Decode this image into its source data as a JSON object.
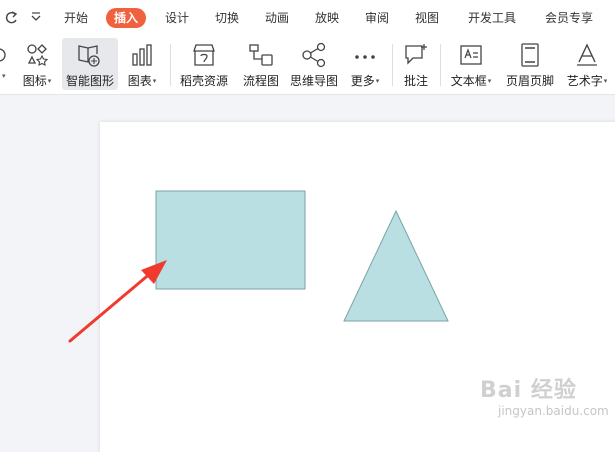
{
  "menubar": {
    "tabs": [
      {
        "key": "home",
        "label": "开始"
      },
      {
        "key": "insert",
        "label": "插入"
      },
      {
        "key": "design",
        "label": "设计"
      },
      {
        "key": "transition",
        "label": "切换"
      },
      {
        "key": "animation",
        "label": "动画"
      },
      {
        "key": "slideshow",
        "label": "放映"
      },
      {
        "key": "review",
        "label": "审阅"
      },
      {
        "key": "view",
        "label": "视图"
      },
      {
        "key": "developer",
        "label": "开发工具"
      },
      {
        "key": "member",
        "label": "会员专享"
      }
    ],
    "active_tab": "插入"
  },
  "ribbon": {
    "icons_label": "图标",
    "smart_shape_label": "智能图形",
    "chart_label": "图表",
    "resources_label": "稻壳资源",
    "flowchart_label": "流程图",
    "mindmap_label": "思维导图",
    "more_label": "更多",
    "comment_label": "批注",
    "textbox_label": "文本框",
    "header_footer_label": "页眉页脚",
    "wordart_label": "艺术字"
  },
  "colors": {
    "accent": "#f0623f",
    "shape_fill": "#b9dfe2",
    "shape_stroke": "#7aa3a6",
    "arrow": "#f03a2e"
  },
  "watermark": {
    "brand": "Bai 经验",
    "url": "jingyan.baidu.com"
  }
}
